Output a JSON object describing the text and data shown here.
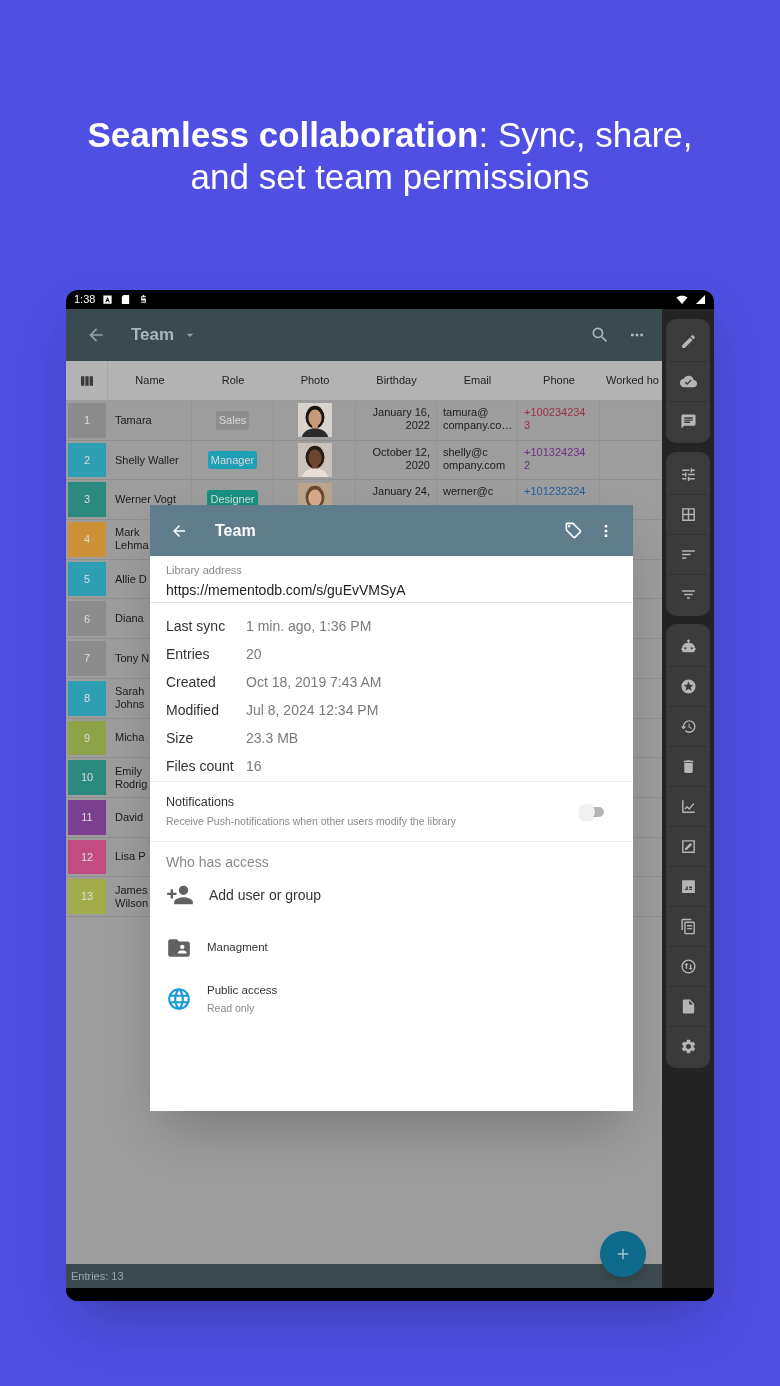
{
  "headline": "**Seamless collaboration**: Sync, share, and set team permissions",
  "status_bar": {
    "time": "1:38"
  },
  "toolbar": {
    "title": "Team"
  },
  "table": {
    "columns": [
      "Name",
      "Role",
      "Photo",
      "Birthday",
      "Email",
      "Phone",
      "Worked ho"
    ],
    "rows": [
      {
        "number": "1",
        "color": "#8c8c8c",
        "name": [
          "Tamara"
        ],
        "role": {
          "label": "Sales",
          "color": "#8e8e8e"
        },
        "photo": {
          "kind": "picture"
        },
        "birthday": [
          "January 16,",
          "2022"
        ],
        "email": [
          "tamura@",
          "company.co…"
        ],
        "phone": {
          "lines": [
            "+100234234",
            "3"
          ],
          "color": "#9c2f45"
        }
      },
      {
        "number": "2",
        "color": "#2e9fb2",
        "name": [
          "Shelly Waller"
        ],
        "role": {
          "label": "Manager",
          "color": "#1f9fb6"
        },
        "photo": {
          "kind": "picture"
        },
        "birthday": [
          "October 12,",
          "2020"
        ],
        "email": [
          "shelly@c",
          "ompany.com"
        ],
        "phone": {
          "lines": [
            "+101324234",
            "2"
          ],
          "color": "#6e2f84"
        }
      },
      {
        "number": "3",
        "color": "#2b8a7d",
        "name": [
          "Werner Vogt"
        ],
        "role": {
          "label": "Designer",
          "color": "#16917f"
        },
        "photo": {
          "kind": "picture"
        },
        "birthday": [
          "January 24,"
        ],
        "email": [
          "werner@c"
        ],
        "phone": {
          "lines": [
            "+101232324"
          ],
          "color": "#1f5f9a"
        }
      },
      {
        "number": "4",
        "color": "#cc9036",
        "name": [
          "Mark",
          "Lehma"
        ]
      },
      {
        "number": "5",
        "color": "#2e9fb2",
        "name": [
          "Allie D"
        ]
      },
      {
        "number": "6",
        "color": "#8c8c8c",
        "name": [
          "Diana"
        ]
      },
      {
        "number": "7",
        "color": "#8c8c8c",
        "name": [
          "Tony N"
        ]
      },
      {
        "number": "8",
        "color": "#2e9fb2",
        "name": [
          "Sarah",
          "Johns"
        ]
      },
      {
        "number": "9",
        "color": "#8ea24a",
        "name": [
          "Micha"
        ]
      },
      {
        "number": "10",
        "color": "#2b8a7d",
        "name": [
          "Emily",
          "Rodrig"
        ]
      },
      {
        "number": "11",
        "color": "#7a3f8e",
        "name": [
          "David"
        ]
      },
      {
        "number": "12",
        "color": "#c24b82",
        "name": [
          "Lisa P"
        ]
      },
      {
        "number": "13",
        "color": "#a3ac4a",
        "name": [
          "James",
          "Wilson"
        ]
      }
    ]
  },
  "dialog": {
    "title": "Team",
    "address_label": "Library address",
    "address": "https://mementodb.com/s/guEvVMSyA",
    "info": [
      {
        "label": "Last sync",
        "value": "1 min. ago, 1:36 PM"
      },
      {
        "label": "Entries",
        "value": "20"
      },
      {
        "label": "Created",
        "value": "Oct 18, 2019 7:43 AM"
      },
      {
        "label": "Modified",
        "value": "Jul 8, 2024 12:34 PM"
      },
      {
        "label": "Size",
        "value": "23.3 MB"
      },
      {
        "label": "Files count",
        "value": "16"
      }
    ],
    "notifications": {
      "title": "Notifications",
      "description": "Receive Push-notifications when other users modify the library",
      "on": false
    },
    "access_heading": "Who has access",
    "access": [
      {
        "kind": "add",
        "title": "Add user or group"
      },
      {
        "kind": "group",
        "title": "Managment"
      },
      {
        "kind": "public",
        "title": "Public access",
        "subtitle": "Read only"
      }
    ]
  },
  "footer": {
    "entries": "Entries: 13"
  }
}
